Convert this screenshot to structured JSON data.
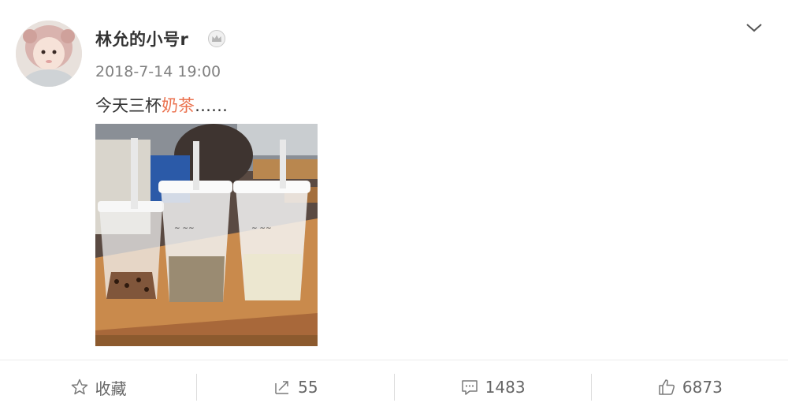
{
  "post": {
    "username": "林允的小号r",
    "timestamp": "2018-7-14 19:00",
    "text_plain": "今天三杯",
    "text_highlight": "奶茶",
    "text_tail": "……"
  },
  "actions": {
    "favorite_label": "收藏",
    "repost_count": "55",
    "comment_count": "1483",
    "like_count": "6873"
  },
  "icons": {
    "more": "chevron-down-icon",
    "crown": "crown-icon",
    "favorite": "star-icon",
    "repost": "repost-icon",
    "comment": "comment-icon",
    "like": "thumbs-up-icon"
  },
  "colors": {
    "accent": "#eb7350",
    "text": "#333333",
    "muted": "#808080"
  }
}
